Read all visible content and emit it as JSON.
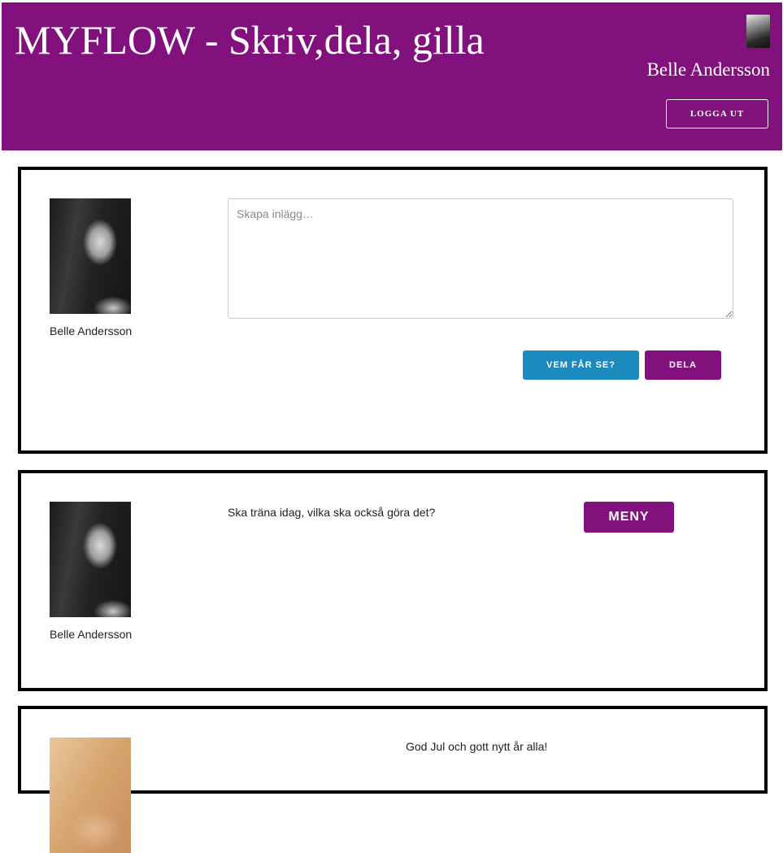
{
  "header": {
    "title": "MYFLOW - Skriv,dela, gilla",
    "user_name": "Belle Andersson",
    "logout_label": "LOGGA UT"
  },
  "composer": {
    "author": "Belle Andersson",
    "placeholder": "Skapa inlägg…",
    "audience_label": "VEM FÅR SE?",
    "share_label": "DELA"
  },
  "posts": [
    {
      "author": "Belle Andersson",
      "text": "Ska träna idag, vilka ska också göra det?",
      "menu_label": "MENY"
    },
    {
      "author": "",
      "text": "God Jul och gott nytt år alla!"
    }
  ],
  "colors": {
    "brand": "#82117e",
    "accent": "#1a8bbc"
  },
  "icons": {
    "header_avatar": "avatar-photo",
    "post_avatar": "avatar-photo"
  }
}
